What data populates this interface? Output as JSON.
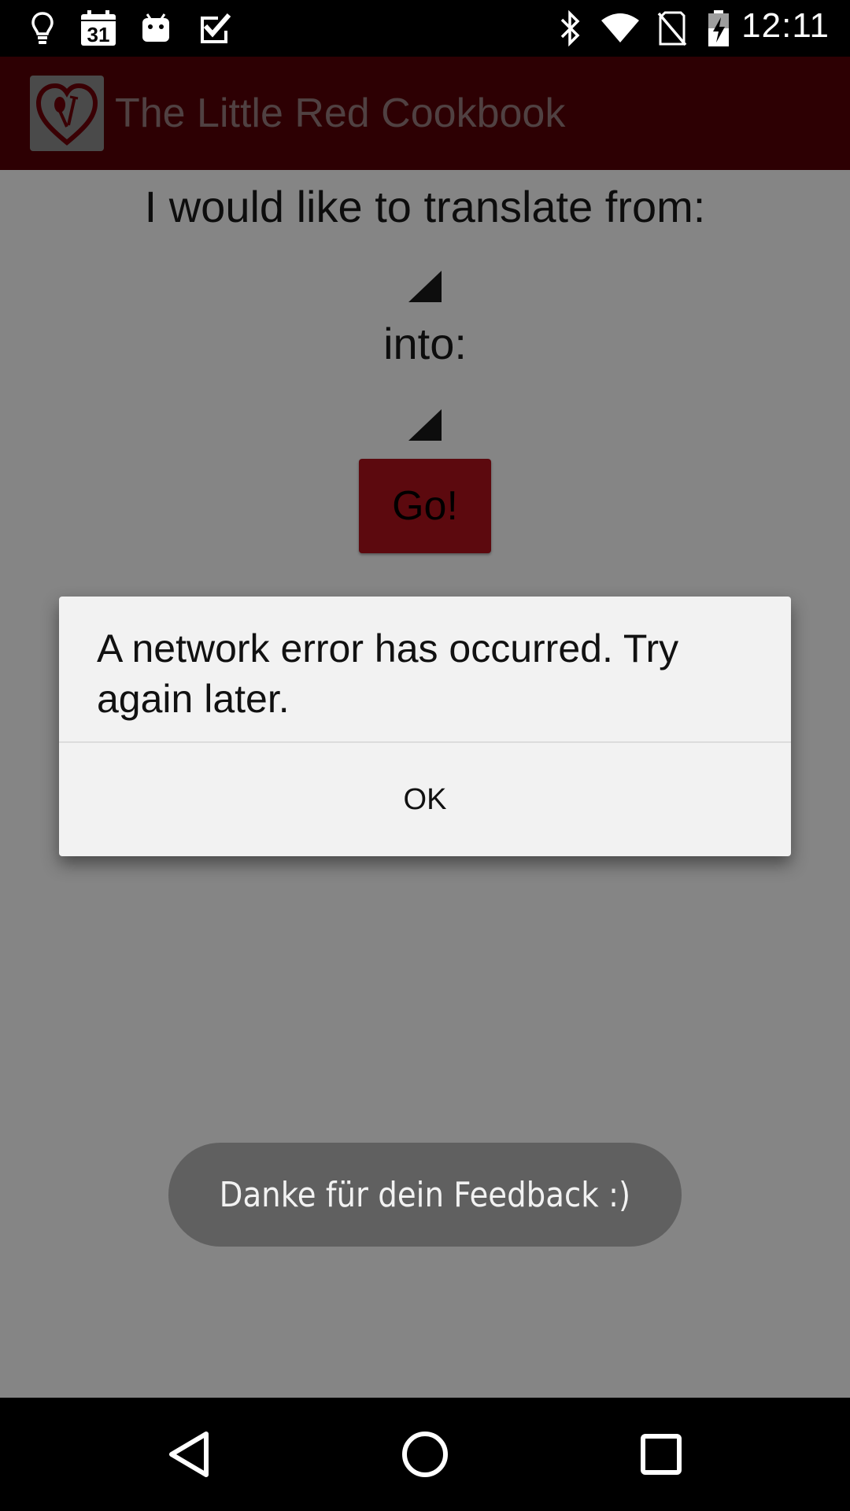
{
  "status_bar": {
    "time": "12:11",
    "calendar_day": "31",
    "icons": [
      "lightbulb-icon",
      "calendar-icon",
      "android-icon",
      "checkbox-icon",
      "bluetooth-icon",
      "wifi-icon",
      "no-sim-icon",
      "battery-charging-icon"
    ]
  },
  "app_bar": {
    "title": "The Little Red Cookbook",
    "logo_icon": "heart-fork-logo-icon",
    "color": "#570006"
  },
  "form": {
    "from_label": "I would like to translate from:",
    "into_label": "into:",
    "go_label": "Go!"
  },
  "dialog": {
    "message": "A network error has occurred. Try again later.",
    "ok_label": "OK"
  },
  "toast": {
    "message": "Danke für dein Feedback :)"
  },
  "nav_bar": {
    "icons": [
      "back-icon",
      "home-icon",
      "recents-icon"
    ]
  },
  "colors": {
    "accent": "#b0121b",
    "app_bar": "#570006"
  }
}
